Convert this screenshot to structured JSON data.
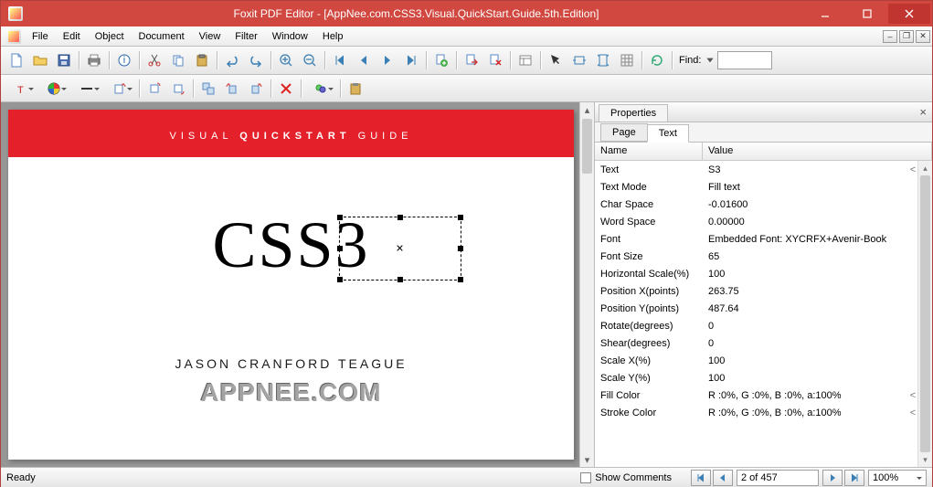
{
  "title": "Foxit PDF Editor - [AppNee.com.CSS3.Visual.QuickStart.Guide.5th.Edition]",
  "menu": {
    "file": "File",
    "edit": "Edit",
    "object": "Object",
    "document": "Document",
    "view": "View",
    "filter": "Filter",
    "window": "Window",
    "help": "Help"
  },
  "find_label": "Find:",
  "document": {
    "banner_pre": "VISUAL ",
    "banner_strong": "QUICKSTART",
    "banner_post": " GUIDE",
    "heading": "CSS3",
    "author": "JASON CRANFORD TEAGUE",
    "watermark": "APPNEE.COM"
  },
  "props": {
    "title": "Properties",
    "tabs": {
      "page": "Page",
      "text": "Text"
    },
    "active_tab": "text",
    "cols": {
      "name": "Name",
      "value": "Value"
    },
    "rows": [
      {
        "name": "Text",
        "value": "S3",
        "trunc": true
      },
      {
        "name": "Text Mode",
        "value": "Fill text"
      },
      {
        "name": "Char Space",
        "value": "-0.01600"
      },
      {
        "name": "Word Space",
        "value": "0.00000"
      },
      {
        "name": "Font",
        "value": "Embedded Font: XYCRFX+Avenir-Book"
      },
      {
        "name": "Font Size",
        "value": "65"
      },
      {
        "name": "Horizontal Scale(%)",
        "value": "100"
      },
      {
        "name": "Position X(points)",
        "value": "263.75"
      },
      {
        "name": "Position Y(points)",
        "value": "487.64"
      },
      {
        "name": "Rotate(degrees)",
        "value": "0"
      },
      {
        "name": "Shear(degrees)",
        "value": "0"
      },
      {
        "name": "Scale X(%)",
        "value": "100"
      },
      {
        "name": "Scale Y(%)",
        "value": "100"
      },
      {
        "name": "Fill Color",
        "value": "R :0%, G :0%, B :0%, a:100%",
        "trunc": true
      },
      {
        "name": "Stroke Color",
        "value": "R :0%, G :0%, B :0%, a:100%",
        "trunc": true
      }
    ]
  },
  "status": {
    "ready": "Ready",
    "show_comments": "Show Comments",
    "page": "2 of 457",
    "zoom": "100%"
  }
}
